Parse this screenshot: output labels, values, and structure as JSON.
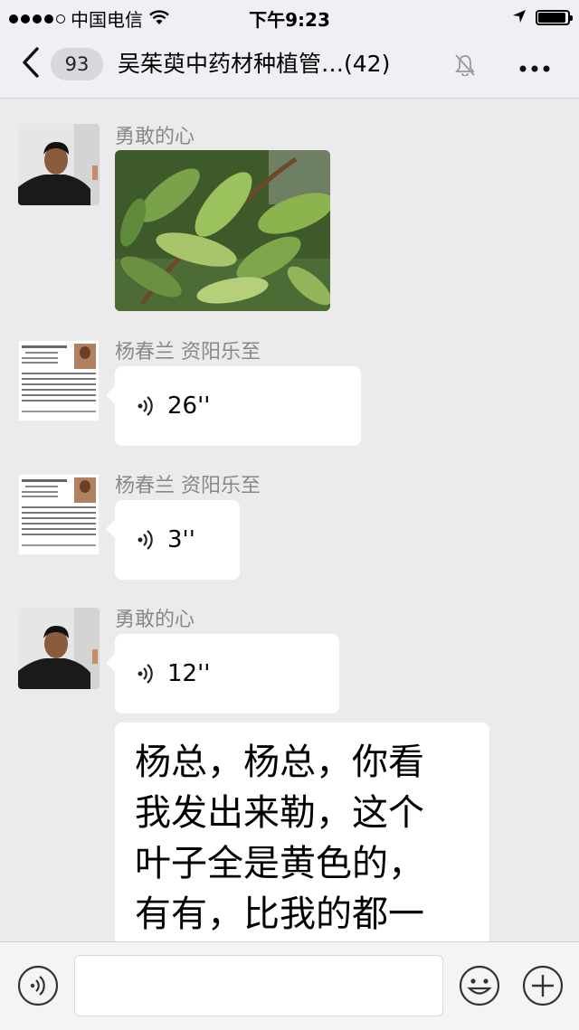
{
  "status_bar": {
    "carrier": "中国电信",
    "time": "下午9:23",
    "battery_level": 0.95,
    "signal_strength": 4,
    "icons": [
      "wifi-icon",
      "location-arrow-icon",
      "battery-icon"
    ]
  },
  "navbar": {
    "unread_count": "93",
    "title": "吴茱萸中药材种植管…(42)",
    "icons": [
      "back-chevron-icon",
      "mute-bell-icon",
      "more-dots-icon"
    ]
  },
  "messages": [
    {
      "sender": "勇敢的心",
      "type": "image"
    },
    {
      "sender": "杨春兰 资阳乐至",
      "type": "voice",
      "duration": "26''"
    },
    {
      "sender": "杨春兰 资阳乐至",
      "type": "voice",
      "duration": "3''"
    },
    {
      "sender": "勇敢的心",
      "type": "voice",
      "duration": "12''"
    },
    {
      "type": "text",
      "lines": [
        "杨总，杨总，你看",
        "我发出来勒，这个",
        "叶子全是黄色的，",
        "有有，比我的都一"
      ]
    }
  ],
  "input_bar": {
    "icons": [
      "voice-mode-icon",
      "emoji-icon",
      "plus-icon"
    ]
  }
}
